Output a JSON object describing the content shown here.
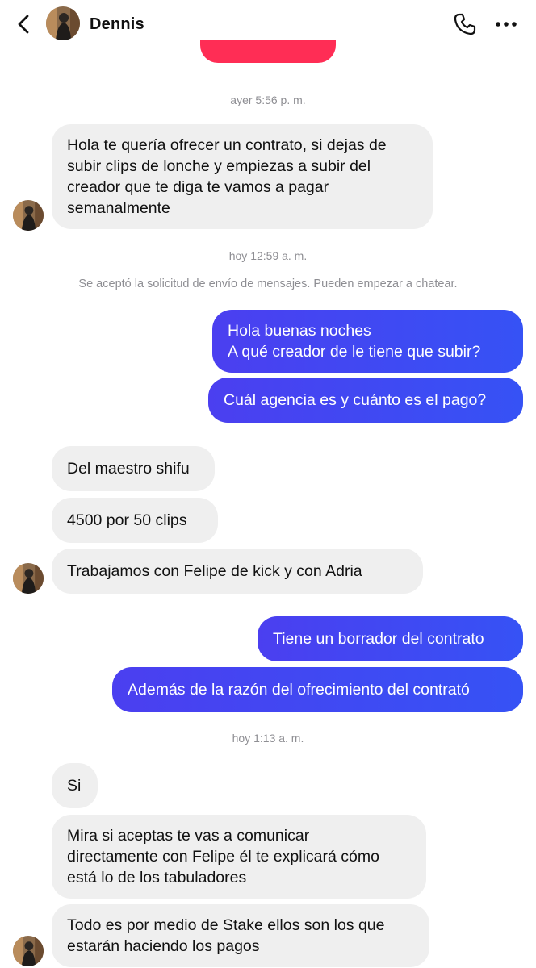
{
  "header": {
    "contact_name": "Dennis",
    "icons": {
      "back": "chevron-left-icon",
      "call": "phone-icon",
      "more": "more-horizontal-icon"
    }
  },
  "colors": {
    "incoming_bubble": "#efefef",
    "outgoing_bubble": "#3d4cf2",
    "accent_bar": "#ff2d55",
    "meta_text": "#8e8e93"
  },
  "thread": {
    "time_1": "ayer 5:56 p. m.",
    "msg_1": {
      "lines": [
        "Hola te quería ofrecer un contrato, si dejas de",
        "subir clips de lonche y empiezas a subir del",
        "creador que te diga te vamos a pagar",
        "semanalmente"
      ]
    },
    "time_2": "hoy 12:59 a. m.",
    "system_note": "Se aceptó la solicitud de envío de mensajes. Pueden empezar a chatear.",
    "msg_2": {
      "lines": [
        "Hola buenas noches",
        "A qué creador de le tiene que subir?"
      ]
    },
    "msg_3": {
      "text": "Cuál agencia es y cuánto es el pago?"
    },
    "msg_4": {
      "text": "Del maestro shifu"
    },
    "msg_5": {
      "text": "4500 por 50 clips"
    },
    "msg_6": {
      "text": "Trabajamos con Felipe de kick y con Adria"
    },
    "msg_7": {
      "text": "Tiene un borrador del contrato"
    },
    "msg_8": {
      "text": "Además de la razón del ofrecimiento del contrató"
    },
    "time_3": "hoy 1:13 a. m.",
    "msg_9": {
      "text": "Si"
    },
    "msg_10": {
      "lines": [
        "Mira si aceptas te vas a comunicar",
        "directamente con Felipe él te explicará cómo",
        "está lo de los tabuladores"
      ]
    },
    "msg_11": {
      "lines": [
        "Todo es por medio de Stake ellos son los que",
        "estarán haciendo los pagos"
      ]
    }
  }
}
